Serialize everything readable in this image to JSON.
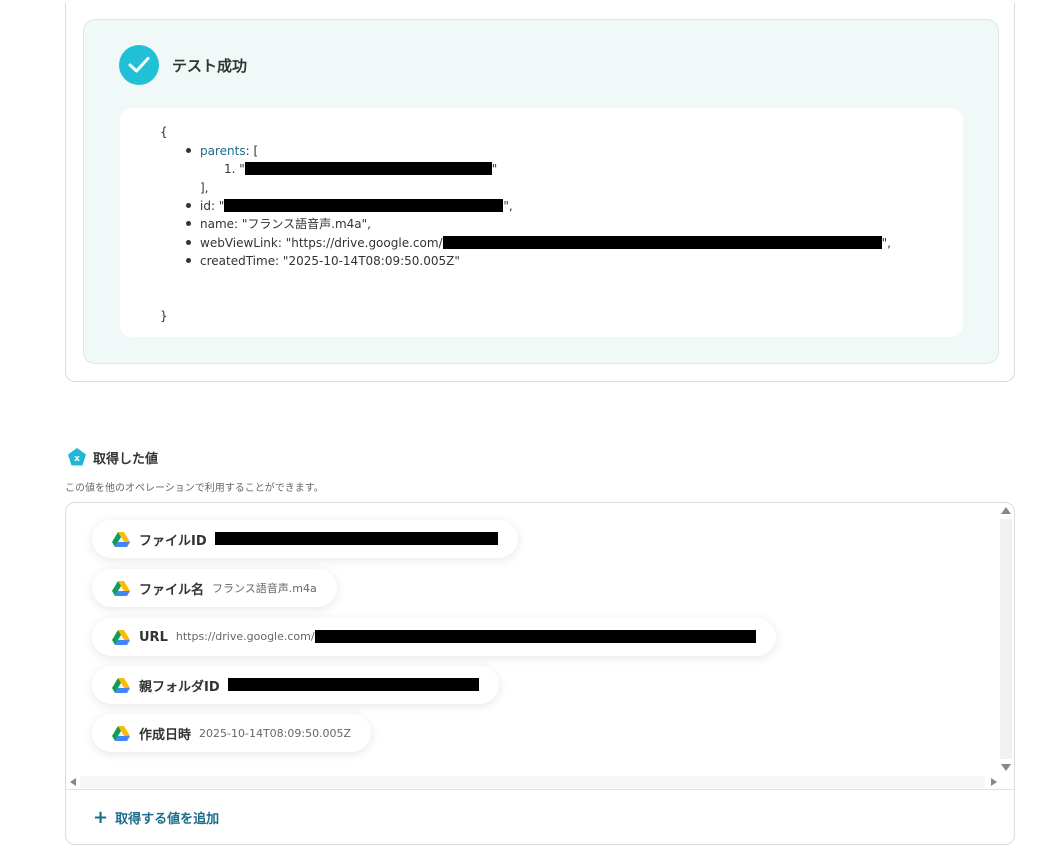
{
  "test_result": {
    "status_title": "テスト成功",
    "json_open": "{",
    "json_close": "}",
    "parents_key": "parents",
    "parents_suffix": ": [",
    "parents_item_prefix": "1. \"",
    "parents_item_suffix": "\"",
    "parents_close": "],",
    "id_prefix": "id: \"",
    "id_suffix": "\",",
    "name_line": "name: \"フランス語音声.m4a\",",
    "webviewlink_prefix": "webViewLink: \"https://drive.google.com/",
    "webviewlink_suffix": "\",",
    "createdtime_line": "createdTime: \"2025-10-14T08:09:50.005Z\""
  },
  "acquired": {
    "title": "取得した値",
    "description": "この値を他のオペレーションで利用することができます。",
    "items": [
      {
        "label": "ファイルID",
        "value": "",
        "icon": "google-drive-icon"
      },
      {
        "label": "ファイル名",
        "value": "フランス語音声.m4a",
        "icon": "google-drive-icon"
      },
      {
        "label": "URL",
        "value": "https://drive.google.com/",
        "icon": "google-drive-icon"
      },
      {
        "label": "親フォルダID",
        "value": "",
        "icon": "google-drive-icon"
      },
      {
        "label": "作成日時",
        "value": "2025-10-14T08:09:50.005Z",
        "icon": "google-drive-icon"
      }
    ],
    "add_label": "取得する値を追加"
  },
  "colors": {
    "accent": "#20c1d6",
    "link": "#1b6d8c",
    "panel_bg": "#f1f9f8"
  }
}
